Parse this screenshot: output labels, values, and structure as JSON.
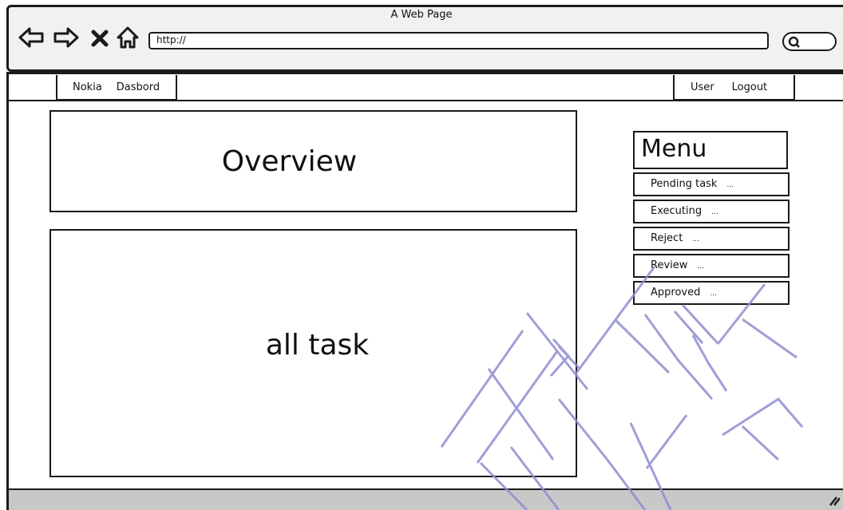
{
  "browser": {
    "window_title": "A Web Page",
    "url": "http://",
    "icons": {
      "back": "back-arrow-icon",
      "forward": "forward-arrow-icon",
      "stop": "close-x-icon",
      "home": "home-icon",
      "search": "search-icon"
    }
  },
  "navbar": {
    "left_items": [
      {
        "label": "Nokia"
      },
      {
        "label": "Dasbord"
      }
    ],
    "right_items": [
      {
        "label": "User"
      },
      {
        "label": "Logout"
      }
    ]
  },
  "main": {
    "overview_title": "Overview",
    "all_task_title": "all task"
  },
  "menu": {
    "title": "Menu",
    "items": [
      {
        "label": "Pending task",
        "dots": "..."
      },
      {
        "label": "Executing",
        "dots": "..."
      },
      {
        "label": "Reject",
        "dots": "..."
      },
      {
        "label": "Review",
        "dots": "..."
      },
      {
        "label": "Approved",
        "dots": "..."
      }
    ]
  },
  "colors": {
    "stroke": "#1a1a1a",
    "chrome_bg": "#f1f1f1",
    "statusbar_bg": "#c8c8c8",
    "watermark": "#8f8fd0"
  }
}
